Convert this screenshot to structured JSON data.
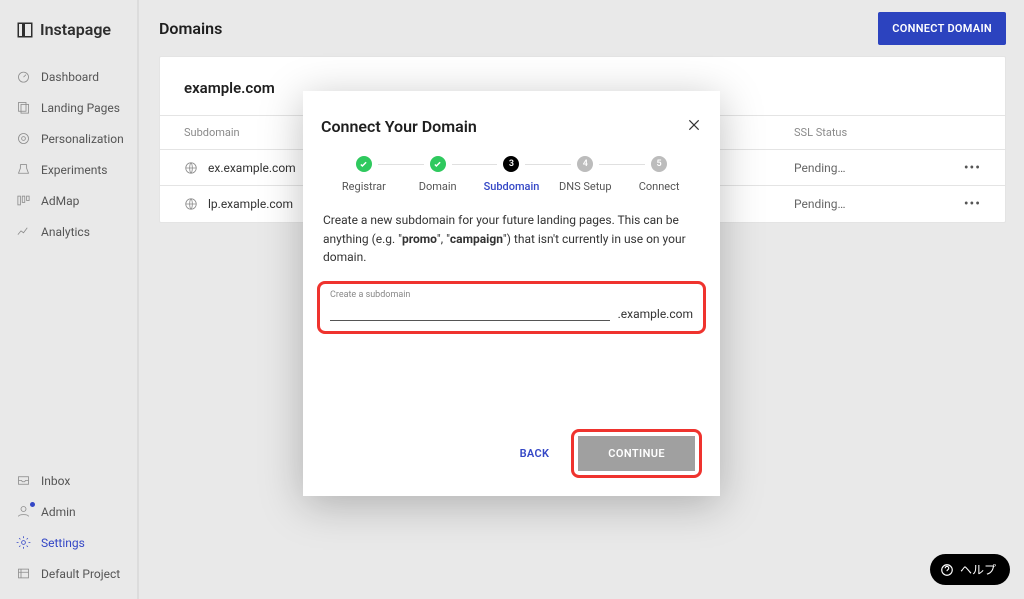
{
  "brand": "Instapage",
  "nav": {
    "items": [
      {
        "label": "Dashboard"
      },
      {
        "label": "Landing Pages"
      },
      {
        "label": "Personalization"
      },
      {
        "label": "Experiments"
      },
      {
        "label": "AdMap"
      },
      {
        "label": "Analytics"
      }
    ],
    "bottom": [
      {
        "label": "Inbox"
      },
      {
        "label": "Admin"
      },
      {
        "label": "Settings"
      },
      {
        "label": "Default Project"
      }
    ]
  },
  "page": {
    "title": "Domains",
    "connect_btn": "CONNECT DOMAIN"
  },
  "panel": {
    "domain": "example.com",
    "col_subdomain": "Subdomain",
    "col_ssl": "SSL Status",
    "rows": [
      {
        "sub": "ex.example.com",
        "ssl": "Pending…"
      },
      {
        "sub": "lp.example.com",
        "ssl": "Pending…"
      }
    ]
  },
  "dialog": {
    "title": "Connect Your Domain",
    "steps": [
      {
        "label": "Registrar"
      },
      {
        "label": "Domain"
      },
      {
        "label": "Subdomain"
      },
      {
        "label": "DNS Setup"
      },
      {
        "label": "Connect"
      }
    ],
    "step_nums": {
      "s3": "3",
      "s4": "4",
      "s5": "5"
    },
    "desc_pre": "Create a new subdomain for your future landing pages. This can be anything (e.g. \"",
    "desc_b1": "promo",
    "desc_mid": "\", \"",
    "desc_b2": "campaign",
    "desc_post": "\") that isn't currently in use on your domain.",
    "field_label": "Create a subdomain",
    "suffix": ".example.com",
    "back": "BACK",
    "continue": "CONTINUE"
  },
  "help": "ヘルプ"
}
